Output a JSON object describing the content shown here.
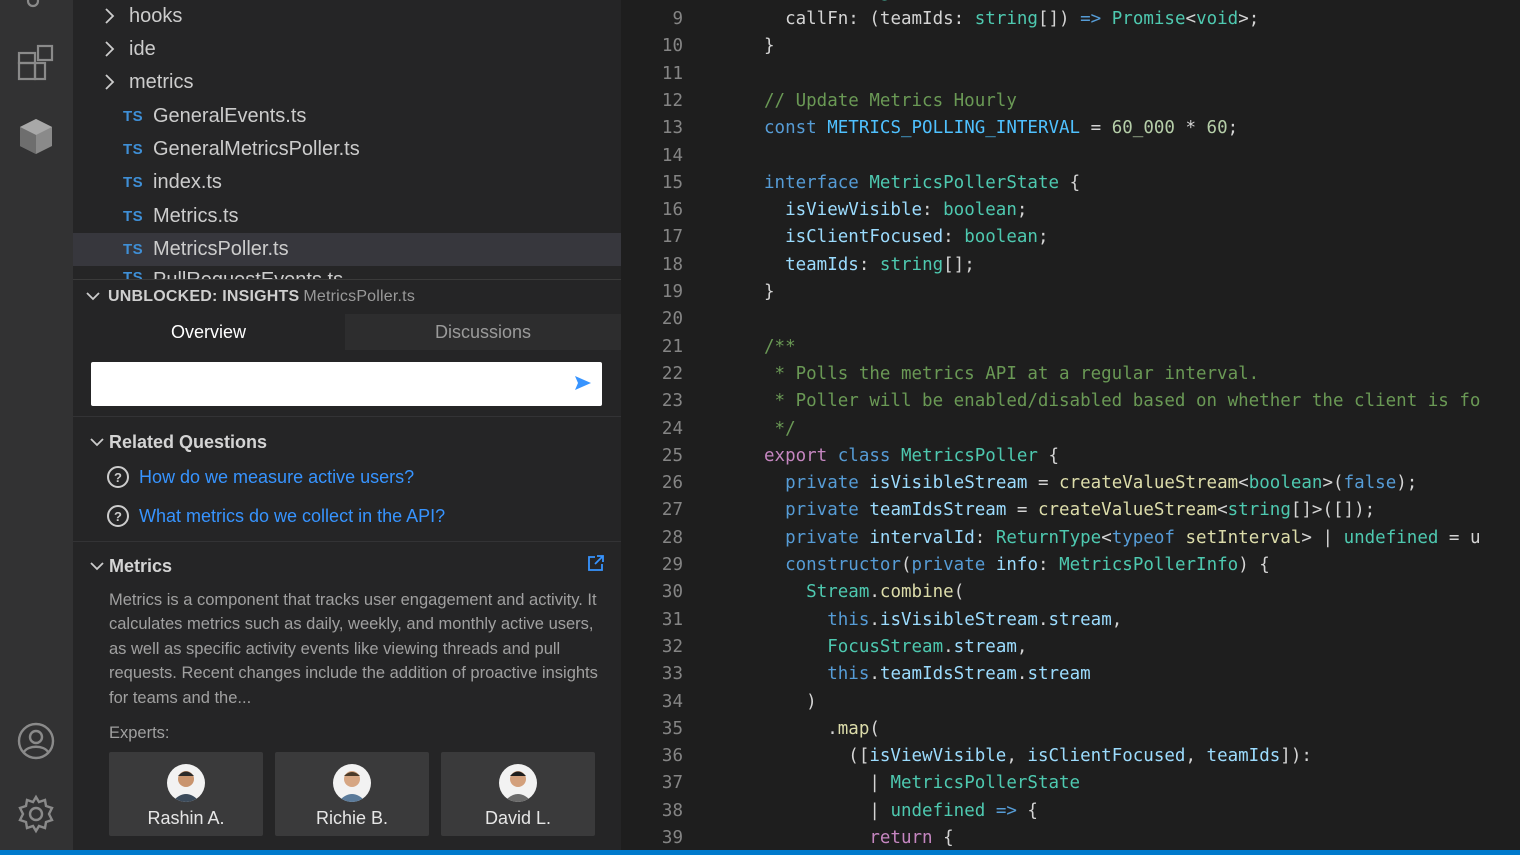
{
  "explorer": {
    "folders": [
      {
        "name": "hooks"
      },
      {
        "name": "ide"
      },
      {
        "name": "metrics"
      }
    ],
    "files": [
      {
        "badge": "TS",
        "name": "GeneralEvents.ts"
      },
      {
        "badge": "TS",
        "name": "GeneralMetricsPoller.ts"
      },
      {
        "badge": "TS",
        "name": "index.ts"
      },
      {
        "badge": "TS",
        "name": "Metrics.ts"
      },
      {
        "badge": "TS",
        "name": "MetricsPoller.ts",
        "selected": true
      }
    ],
    "partial_file": {
      "badge": "TS",
      "name": "PullRequestEvents.ts"
    }
  },
  "insights": {
    "title": "UNBLOCKED: INSIGHTS",
    "file": "MetricsPoller.ts",
    "tabs": {
      "overview": "Overview",
      "discussions": "Discussions"
    },
    "ask_placeholder": "",
    "related_title": "Related Questions",
    "questions": [
      "How do we measure active users?",
      "What metrics do we collect in the API?"
    ],
    "metrics_title": "Metrics",
    "metrics_description": "Metrics is a component that tracks user engagement and activity. It calculates metrics such as daily, weekly, and monthly active users, as well as specific activity events like viewing threads and pull requests. Recent changes include the addition of proactive insights for teams and the...",
    "experts_label": "Experts:",
    "experts": [
      "Rashin A.",
      "Richie B.",
      "David L."
    ]
  },
  "editor": {
    "line_numbers": [
      "9",
      "10",
      "11",
      "12",
      "13",
      "14",
      "15",
      "16",
      "17",
      "18",
      "19",
      "20",
      "21",
      "22",
      "23",
      "24",
      "25",
      "26",
      "27",
      "28",
      "29",
      "30",
      "31",
      "32",
      "33",
      "34",
      "35",
      "36",
      "37",
      "38",
      "39"
    ],
    "lines": [
      [
        [
          "  ",
          ""
        ],
        [
          "callFn",
          ""
        ],
        [
          ": (",
          ""
        ],
        [
          "teamIds",
          ""
        ],
        [
          ": ",
          ""
        ],
        [
          "string",
          "ty"
        ],
        [
          "[]) ",
          ""
        ],
        [
          "=>",
          "kw"
        ],
        [
          " ",
          ""
        ],
        [
          "Promise",
          "ty"
        ],
        [
          "<",
          ""
        ],
        [
          "void",
          "ty"
        ],
        [
          ">;",
          ""
        ]
      ],
      [
        [
          "}",
          ""
        ]
      ],
      [],
      [
        [
          "// Update Metrics Hourly",
          "cm"
        ]
      ],
      [
        [
          "const",
          "kw"
        ],
        [
          " ",
          ""
        ],
        [
          "METRICS_POLLING_INTERVAL",
          "ct"
        ],
        [
          " = ",
          ""
        ],
        [
          "60_000",
          "nu"
        ],
        [
          " * ",
          ""
        ],
        [
          "60",
          "nu"
        ],
        [
          ";",
          ""
        ]
      ],
      [],
      [
        [
          "interface",
          "kw"
        ],
        [
          " ",
          ""
        ],
        [
          "MetricsPollerState",
          "ty"
        ],
        [
          " {",
          ""
        ]
      ],
      [
        [
          "  ",
          ""
        ],
        [
          "isViewVisible",
          "vr"
        ],
        [
          ": ",
          ""
        ],
        [
          "boolean",
          "ty"
        ],
        [
          ";",
          ""
        ]
      ],
      [
        [
          "  ",
          ""
        ],
        [
          "isClientFocused",
          "vr"
        ],
        [
          ": ",
          ""
        ],
        [
          "boolean",
          "ty"
        ],
        [
          ";",
          ""
        ]
      ],
      [
        [
          "  ",
          ""
        ],
        [
          "teamIds",
          "vr"
        ],
        [
          ": ",
          ""
        ],
        [
          "string",
          "ty"
        ],
        [
          "[];",
          ""
        ]
      ],
      [
        [
          "}",
          ""
        ]
      ],
      [],
      [
        [
          "/**",
          "cm"
        ]
      ],
      [
        [
          " * Polls the metrics API at a regular interval.",
          "cm"
        ]
      ],
      [
        [
          " * Poller will be enabled/disabled based on whether the client is fo",
          "cm"
        ]
      ],
      [
        [
          " */",
          "cm"
        ]
      ],
      [
        [
          "export",
          "pk"
        ],
        [
          " ",
          ""
        ],
        [
          "class",
          "kw"
        ],
        [
          " ",
          ""
        ],
        [
          "MetricsPoller",
          "ty"
        ],
        [
          " {",
          ""
        ]
      ],
      [
        [
          "  ",
          ""
        ],
        [
          "private",
          "kw"
        ],
        [
          " ",
          ""
        ],
        [
          "isVisibleStream",
          "vr"
        ],
        [
          " = ",
          ""
        ],
        [
          "createValueStream",
          "fn"
        ],
        [
          "<",
          ""
        ],
        [
          "boolean",
          "ty"
        ],
        [
          ">(",
          ""
        ],
        [
          "false",
          "kw"
        ],
        [
          ");",
          ""
        ]
      ],
      [
        [
          "  ",
          ""
        ],
        [
          "private",
          "kw"
        ],
        [
          " ",
          ""
        ],
        [
          "teamIdsStream",
          "vr"
        ],
        [
          " = ",
          ""
        ],
        [
          "createValueStream",
          "fn"
        ],
        [
          "<",
          ""
        ],
        [
          "string",
          "ty"
        ],
        [
          "[]>([]);",
          ""
        ]
      ],
      [
        [
          "  ",
          ""
        ],
        [
          "private",
          "kw"
        ],
        [
          " ",
          ""
        ],
        [
          "intervalId",
          "vr"
        ],
        [
          ": ",
          ""
        ],
        [
          "ReturnType",
          "ty"
        ],
        [
          "<",
          ""
        ],
        [
          "typeof",
          "kw"
        ],
        [
          " ",
          ""
        ],
        [
          "setInterval",
          "fn"
        ],
        [
          "> | ",
          ""
        ],
        [
          "undefined",
          "ty"
        ],
        [
          " = u",
          ""
        ]
      ],
      [
        [
          "  ",
          ""
        ],
        [
          "constructor",
          "kw"
        ],
        [
          "(",
          ""
        ],
        [
          "private",
          "kw"
        ],
        [
          " ",
          ""
        ],
        [
          "info",
          "vr"
        ],
        [
          ": ",
          ""
        ],
        [
          "MetricsPollerInfo",
          "ty"
        ],
        [
          ") {",
          ""
        ]
      ],
      [
        [
          "    ",
          ""
        ],
        [
          "Stream",
          "ty"
        ],
        [
          ".",
          ""
        ],
        [
          "combine",
          "fn"
        ],
        [
          "(",
          ""
        ]
      ],
      [
        [
          "      ",
          ""
        ],
        [
          "this",
          "kw"
        ],
        [
          ".",
          ""
        ],
        [
          "isVisibleStream",
          "vr"
        ],
        [
          ".",
          ""
        ],
        [
          "stream",
          "vr"
        ],
        [
          ",",
          ""
        ]
      ],
      [
        [
          "      ",
          ""
        ],
        [
          "FocusStream",
          "ty"
        ],
        [
          ".",
          ""
        ],
        [
          "stream",
          "vr"
        ],
        [
          ",",
          ""
        ]
      ],
      [
        [
          "      ",
          ""
        ],
        [
          "this",
          "kw"
        ],
        [
          ".",
          ""
        ],
        [
          "teamIdsStream",
          "vr"
        ],
        [
          ".",
          ""
        ],
        [
          "stream",
          "vr"
        ]
      ],
      [
        [
          "    )",
          ""
        ]
      ],
      [
        [
          "      .",
          ""
        ],
        [
          "map",
          "fn"
        ],
        [
          "(",
          ""
        ]
      ],
      [
        [
          "        ([",
          ""
        ],
        [
          "isViewVisible",
          "vr"
        ],
        [
          ", ",
          ""
        ],
        [
          "isClientFocused",
          "vr"
        ],
        [
          ", ",
          ""
        ],
        [
          "teamIds",
          "vr"
        ],
        [
          "]):",
          ""
        ]
      ],
      [
        [
          "          | ",
          ""
        ],
        [
          "MetricsPollerState",
          "ty"
        ]
      ],
      [
        [
          "          | ",
          ""
        ],
        [
          "undefined",
          "ty"
        ],
        [
          " ",
          ""
        ],
        [
          "=>",
          "kw"
        ],
        [
          " {",
          ""
        ]
      ],
      [
        [
          "          ",
          ""
        ],
        [
          "return",
          "pk"
        ],
        [
          " {",
          ""
        ]
      ]
    ]
  },
  "colors": {
    "accent": "#3794ff",
    "status_bar": "#007acc",
    "ts_badge": "#3f8fd6"
  },
  "icons": [
    "search-icon",
    "extensions-icon",
    "remote-box-icon",
    "account-icon",
    "settings-gear-icon",
    "chevron-right-icon",
    "chevron-down-icon",
    "send-arrow-icon",
    "question-circle-icon",
    "external-link-icon"
  ]
}
